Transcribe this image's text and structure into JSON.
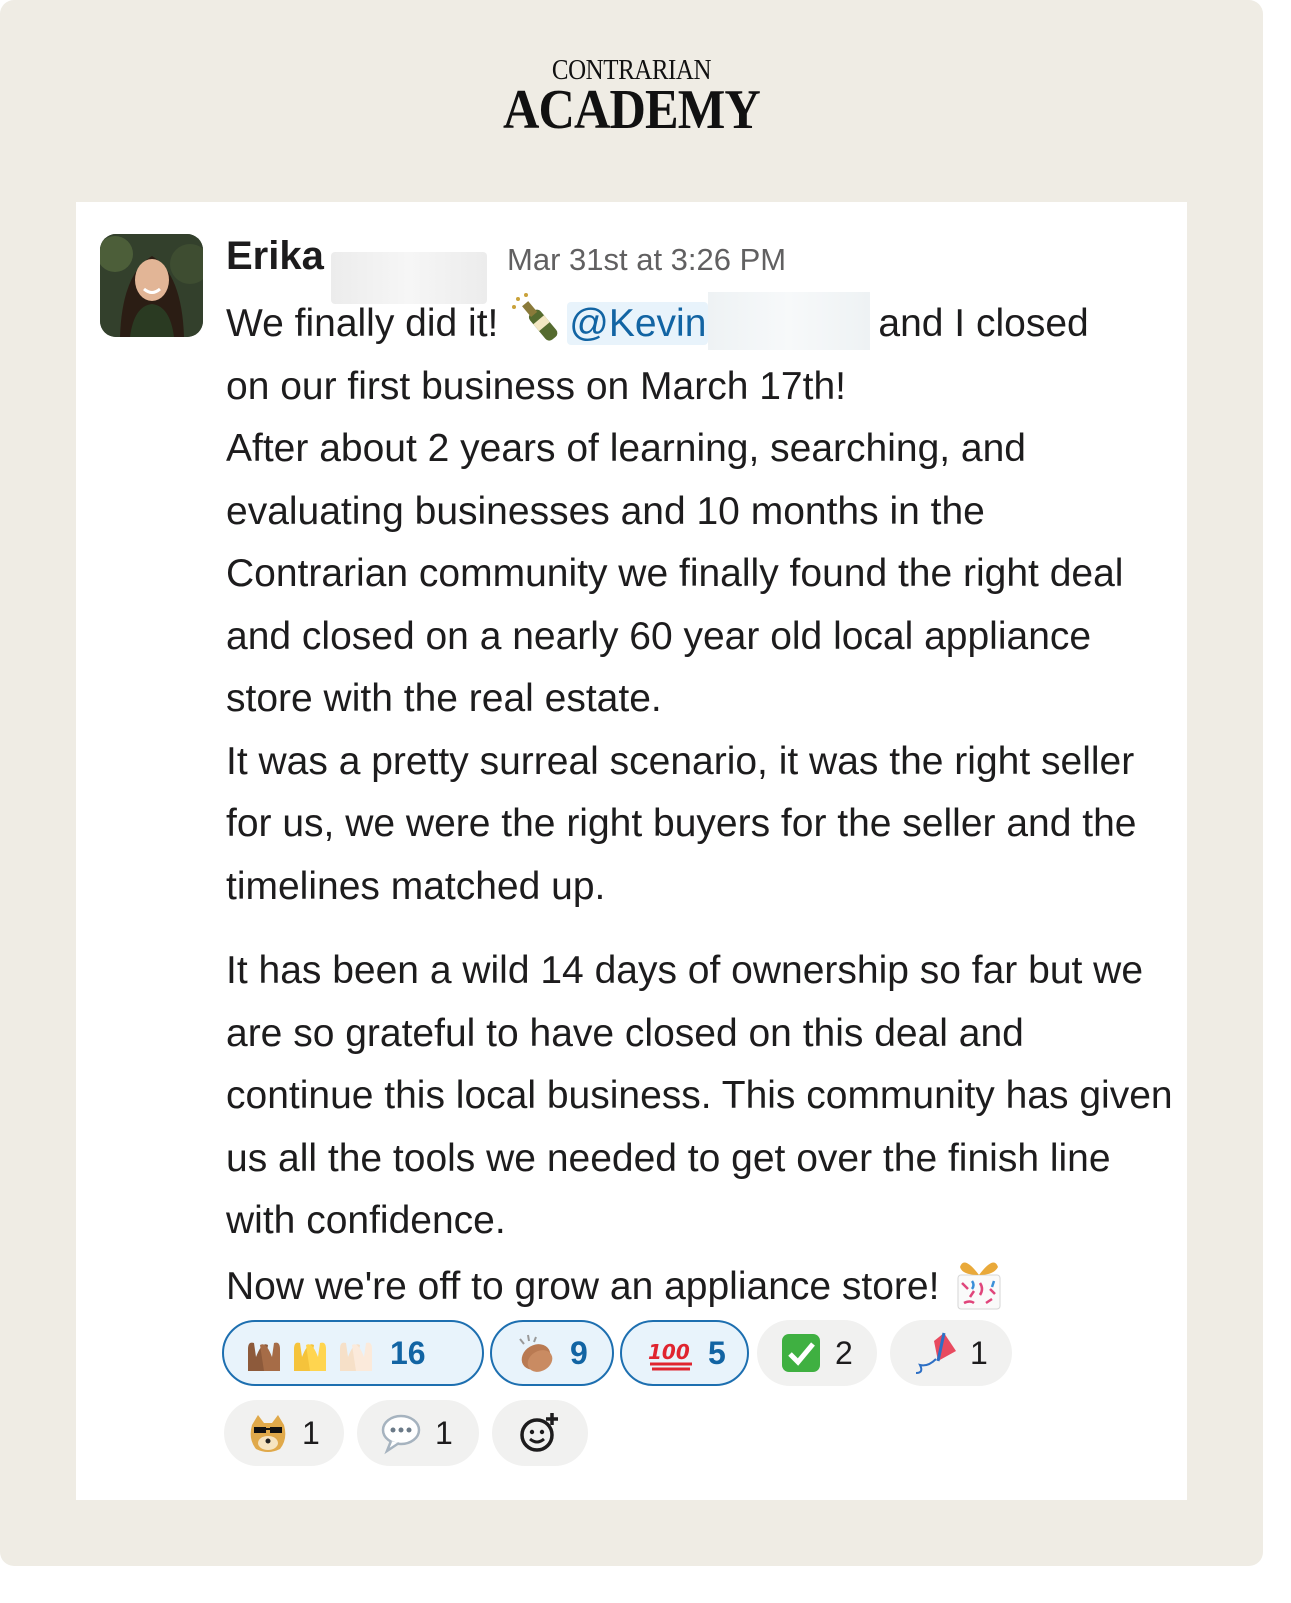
{
  "logo": {
    "top": "CONTRARIAN",
    "main": "ACADEMY"
  },
  "message": {
    "author": "Erika",
    "timestamp": "Mar 31st at 3:26 PM",
    "line1_before": "We finally did it!",
    "mention": "@Kevin",
    "line1_after": "and I closed",
    "line2": "on our first business on March 17th!",
    "paragraph2": "After about 2 years of learning, searching, and evaluating businesses and 10 months in the Contrarian community we finally found the right deal and closed on a nearly 60 year old local appliance store with the real estate.",
    "paragraph3": "It was a pretty surreal scenario, it was the right seller for us, we were the right buyers for the seller and the timelines matched up.",
    "paragraph4": "It has been a wild 14 days of ownership so far but we are so grateful to have closed on this deal and continue this local business. This community has given us all the tools we needed to get over the finish line with confidence.",
    "closing": "Now we're off to grow an appliance store!"
  },
  "reactions": [
    {
      "icon": "raised-hands-icon",
      "count": "16",
      "active": true
    },
    {
      "icon": "clapping-hands-icon",
      "count": "9",
      "active": true
    },
    {
      "icon": "hundred-points-icon",
      "count": "5",
      "active": true
    },
    {
      "icon": "check-mark-button-icon",
      "count": "2",
      "active": false
    },
    {
      "icon": "kite-icon",
      "count": "1",
      "active": false
    },
    {
      "icon": "cool-doge-icon",
      "count": "1",
      "active": false
    },
    {
      "icon": "speech-bubble-icon",
      "count": "1",
      "active": false
    }
  ],
  "colors": {
    "mention": "#1264a3",
    "reaction_active_border": "#1d6fb0",
    "background": "#efece4"
  }
}
